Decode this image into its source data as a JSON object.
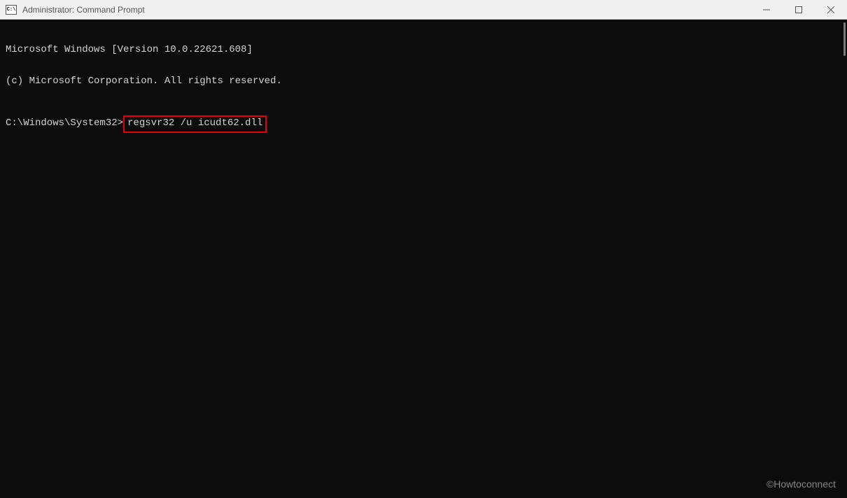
{
  "titlebar": {
    "title": "Administrator: Command Prompt",
    "icon_label": "C:\\"
  },
  "terminal": {
    "line1": "Microsoft Windows [Version 10.0.22621.608]",
    "line2": "(c) Microsoft Corporation. All rights reserved.",
    "prompt": "C:\\Windows\\System32>",
    "command": "regsvr32 /u icudt62.dll"
  },
  "watermark": "©Howtoconnect"
}
